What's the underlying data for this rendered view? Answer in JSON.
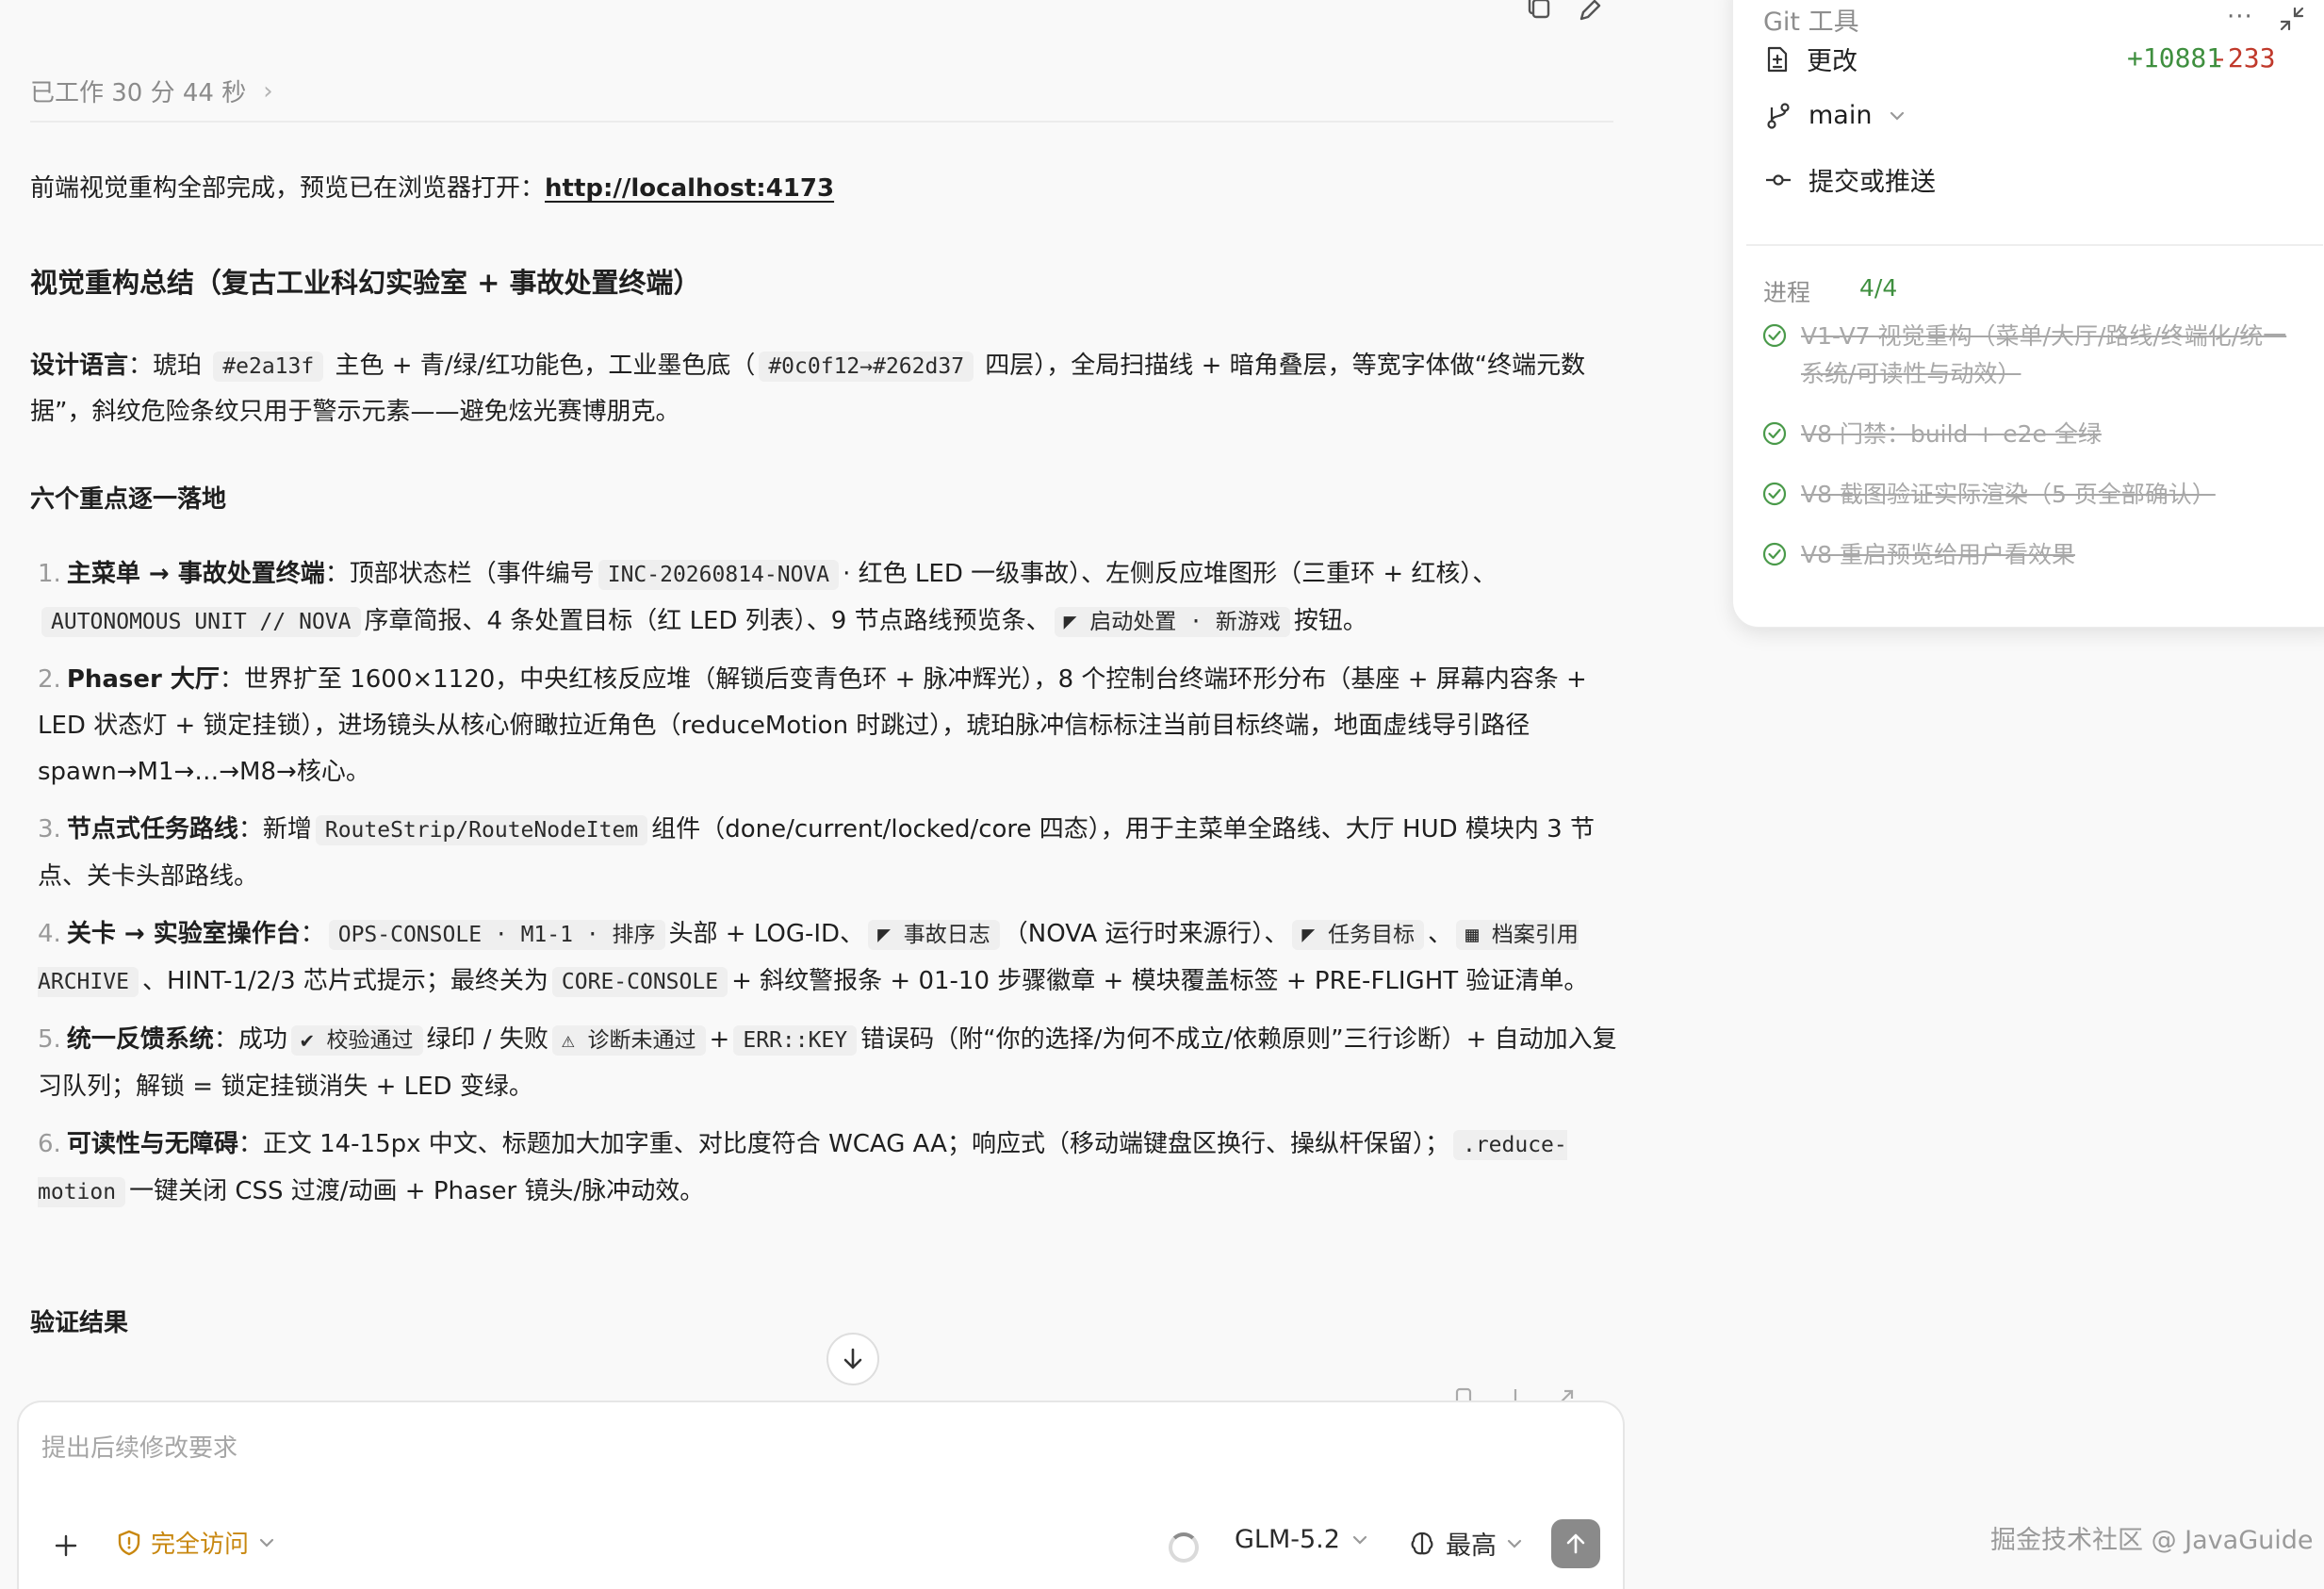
{
  "chat": {
    "worked_status": "已工作 30 分 44 秒",
    "intro_text": "前端视觉重构全部完成，预览已在浏览器打开：",
    "intro_link": "http://localhost:4173",
    "summary_heading": "视觉重构总结（复古工业科幻实验室 + 事故处置终端）",
    "design": {
      "label": "设计语言",
      "part1": "：琥珀 ",
      "code1": "#e2a13f",
      "part2": " 主色 + 青/绿/红功能色，工业墨色底（",
      "code2": "#0c0f12→#262d37",
      "part3": " 四层），全局扫描线 + 暗角叠层，等宽字体做“终端元数据”，斜纹危险条纹只用于警示元素——避免炫光赛博朋克。"
    },
    "six_heading": "六个重点逐一落地",
    "points": [
      {
        "num": "1.",
        "title": "主菜单 → 事故处置终端",
        "t1": "：顶部状态栏（事件编号",
        "c1": "INC-20260814-NOVA",
        "t2": "· 红色 LED 一级事故）、左侧反应堆图形（三重环 + 红核）、",
        "c2": "AUTONOMOUS UNIT // NOVA",
        "t3": "序章简报、4 条处置目标（红 LED 列表）、9 节点路线预览条、",
        "c3": "◤ 启动处置 · 新游戏",
        "t4": "按钮。"
      },
      {
        "num": "2.",
        "title": "Phaser 大厅",
        "t1": "：世界扩至 1600×1120，中央红核反应堆（解锁后变青色环 + 脉冲辉光），8 个控制台终端环形分布（基座 + 屏幕内容条 + LED 状态灯 + 锁定挂锁），进场镜头从核心俯瞰拉近角色（reduceMotion 时跳过），琥珀脉冲信标标注当前目标终端，地面虚线导引路径 spawn→M1→…→M8→核心。"
      },
      {
        "num": "3.",
        "title": "节点式任务路线",
        "t1": "：新增",
        "c1": "RouteStrip/RouteNodeItem",
        "t2": "组件（done/current/locked/core 四态），用于主菜单全路线、大厅 HUD 模块内 3 节点、关卡头部路线。"
      },
      {
        "num": "4.",
        "title": "关卡 → 实验室操作台",
        "t1": "：",
        "c1": "OPS-CONSOLE · M1-1 · 排序",
        "t2": "头部 + LOG-ID、",
        "c2": "◤ 事故日志",
        "t3": "（NOVA 运行时来源行）、",
        "c3": "◤ 任务目标",
        "t4": "、",
        "c4": "▦ 档案引用 ARCHIVE",
        "t5": "、HINT-1/2/3 芯片式提示；最终关为",
        "c5": "CORE-CONSOLE",
        "t6": "+ 斜纹警报条 + 01-10 步骤徽章 + 模块覆盖标签 + PRE-FLIGHT 验证清单。"
      },
      {
        "num": "5.",
        "title": "统一反馈系统",
        "t1": "：成功",
        "c1": "✔ 校验通过",
        "t2": "绿印 / 失败",
        "c2": "⚠ 诊断未通过",
        "t3": "+",
        "c3": "ERR::KEY",
        "t4": "错误码（附“你的选择/为何不成立/依赖原则”三行诊断）+ 自动加入复习队列；解锁 = 锁定挂锁消失 + LED 变绿。"
      },
      {
        "num": "6.",
        "title": "可读性与无障碍",
        "t1": "：正文 14-15px 中文、标题加大加字重、对比度符合 WCAG AA；响应式（移动端键盘区换行、操纵杆保留）；",
        "c1": ".reduce-motion",
        "t2": "一键关闭 CSS 过渡/动画 + Phaser 镜头/脉冲动效。"
      }
    ],
    "verify_heading": "验证结果"
  },
  "composer": {
    "placeholder": "提出后续修改要求",
    "access_label": "完全访问",
    "model_label": "GLM-5.2",
    "reasoning_label": "最高"
  },
  "git": {
    "title": "Git 工具",
    "more": "···",
    "changes_label": "更改",
    "additions": "+10881",
    "deletions": "-233",
    "branch": "main",
    "commit_label": "提交或推送",
    "progress_label": "进程",
    "progress_count": "4/4",
    "tasks": [
      "V1-V7 视觉重构（菜单/大厅/路线/终端化/统一系统/可读性与动效）",
      "V8 门禁：build + e2e 全绿",
      "V8 截图验证实际渲染（5 页全部确认）",
      "V8 重启预览给用户看效果"
    ]
  },
  "watermark": "掘金技术社区 @ JavaGuide",
  "colors": {
    "accent_warning": "#c8870f",
    "additions": "#3f8f3f",
    "deletions": "#c0392b"
  }
}
